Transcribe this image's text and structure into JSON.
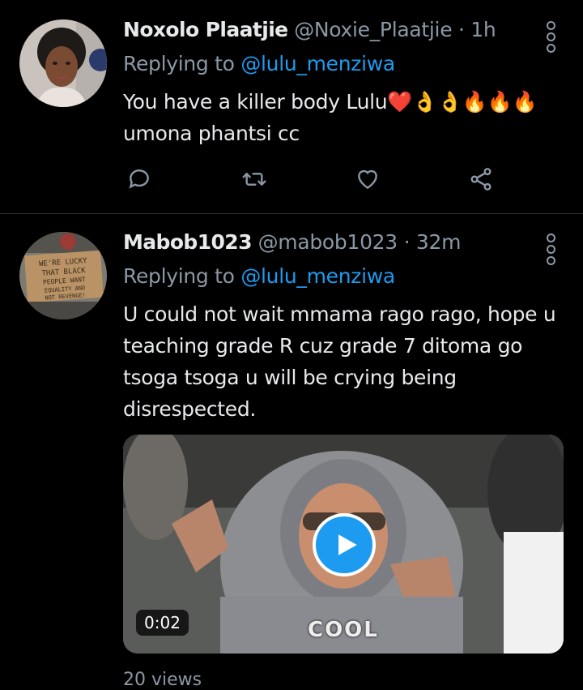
{
  "tweets": [
    {
      "name": "Noxolo Plaatjie",
      "handle": "@Noxie_Plaatjie",
      "separator": "·",
      "time": "1h",
      "replying_prefix": "Replying to",
      "replying_to": "@lulu_menziwa",
      "text_line1": "You have a killer body Lulu",
      "emoji": "❤️👌👌🔥🔥🔥",
      "text_line2": "umona phantsi cc",
      "actions": [
        "reply-icon",
        "retweet-icon",
        "like-icon",
        "share-icon"
      ]
    },
    {
      "name": "Mabob1023",
      "handle": "@mabob1023",
      "separator": "·",
      "time": "32m",
      "replying_prefix": "Replying to",
      "replying_to": "@lulu_menziwa",
      "text": "U could not wait mmama rago rago, hope u teaching grade R cuz grade 7 ditoma go tsoga tsoga u will be crying being disrespected.",
      "avatar_sign_text": "WE'RE LUCKY THAT BLACK PEOPLE WANT EQUALITY AND NOT REVENGE",
      "media": {
        "duration": "0:02",
        "caption": "COOL"
      },
      "views": "20 views"
    }
  ],
  "colors": {
    "background": "#000000",
    "text": "#e7e9ea",
    "secondary": "#8b98a5",
    "accent": "#1d9bf0"
  }
}
